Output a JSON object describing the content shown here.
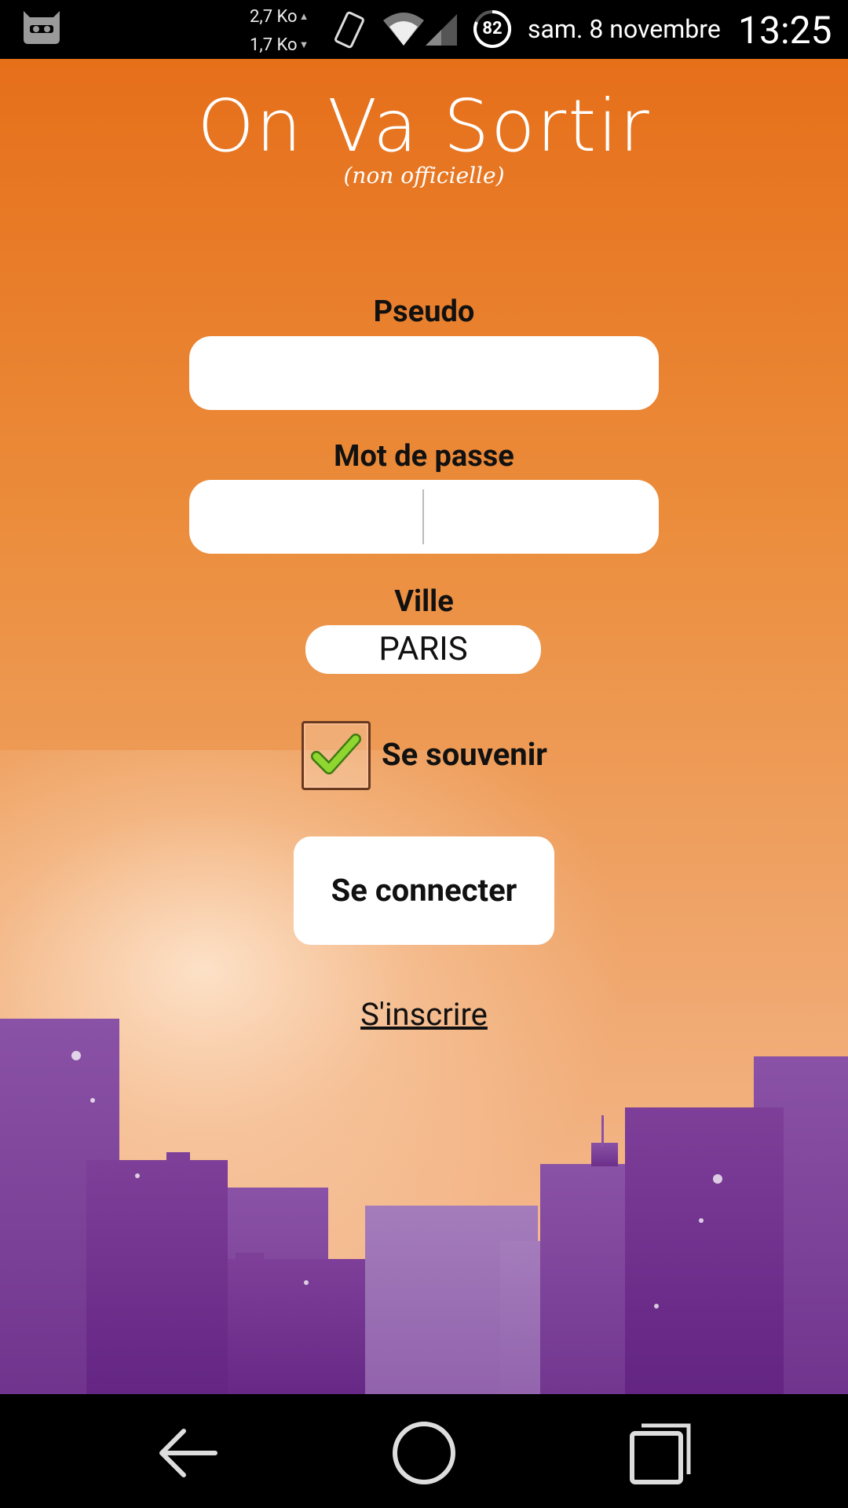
{
  "status_bar": {
    "upload": "2,7 Ko",
    "download": "1,7 Ko",
    "battery": "82",
    "date": "sam. 8 novembre",
    "time": "13:25",
    "icons": [
      "cyanogenmod-icon",
      "phone-rotate-icon",
      "wifi-icon",
      "signal-icon",
      "battery-icon"
    ]
  },
  "app": {
    "title": "On Va Sortir",
    "subtitle": "(non officielle)",
    "form": {
      "pseudo_label": "Pseudo",
      "pseudo_value": "",
      "password_label": "Mot de passe",
      "password_value": "",
      "city_label": "Ville",
      "city_value": "PARIS",
      "remember_label": "Se souvenir",
      "remember_checked": true,
      "connect_label": "Se connecter",
      "signup_label": "S'inscrire"
    },
    "colors": {
      "background_top": "#e66f1a",
      "background_bottom": "#f7c39f",
      "buildings": "#7a3b96",
      "check": "#7ccc2a"
    }
  },
  "nav_bar": {
    "icons": [
      "back-icon",
      "home-icon",
      "recents-icon"
    ]
  }
}
